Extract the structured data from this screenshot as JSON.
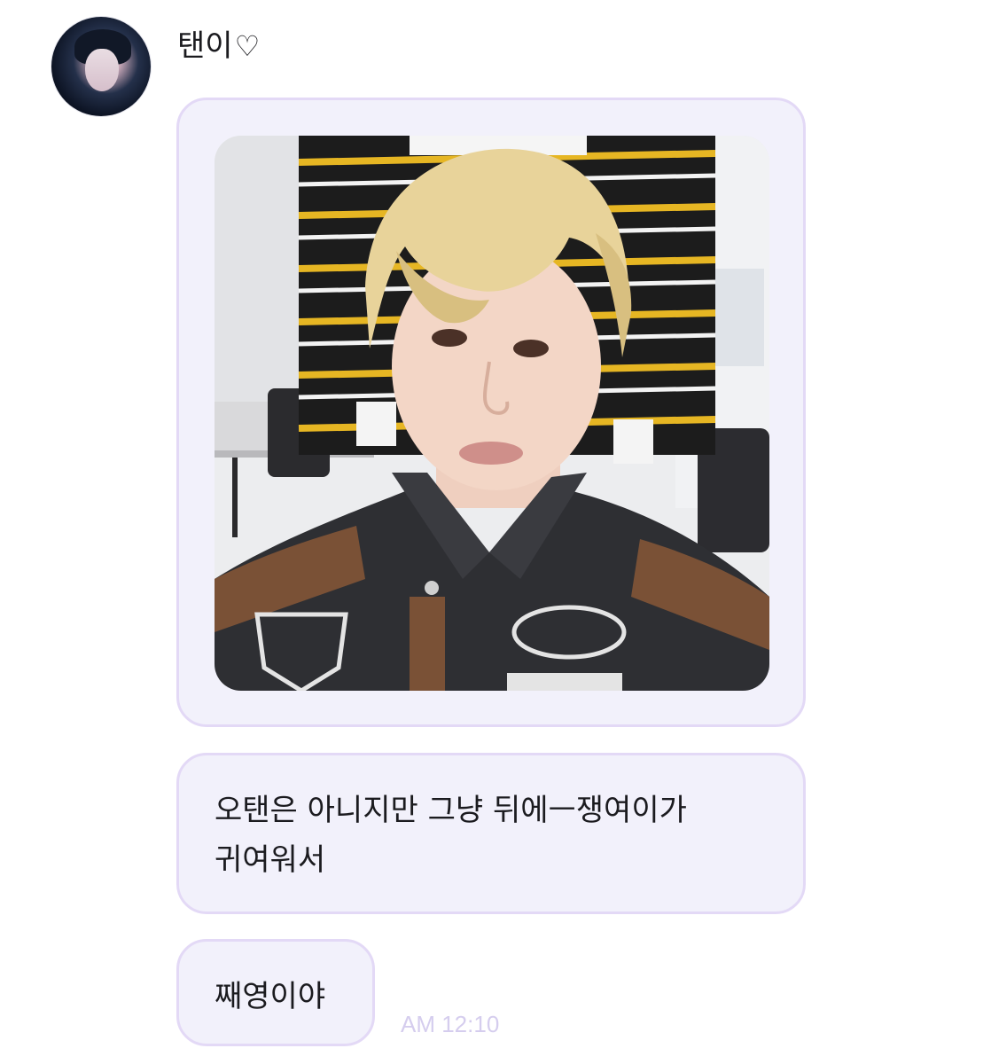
{
  "sender": {
    "name": "탠이",
    "name_icon": "heart-outline-icon",
    "name_icon_glyph": "♡"
  },
  "messages": [
    {
      "type": "image",
      "subject": "selfie-photo"
    },
    {
      "type": "text",
      "text": "오탠은 아니지만 그냥 뒤에ㅡ쟁여이가 귀여워서"
    },
    {
      "type": "text",
      "text": "째영이야"
    }
  ],
  "timestamp": "AM 12:10",
  "colors": {
    "bubble_bg": "#f2f1fb",
    "bubble_border": "#e3d9f6",
    "timestamp": "#d5cdee",
    "text": "#1b1b1f"
  }
}
